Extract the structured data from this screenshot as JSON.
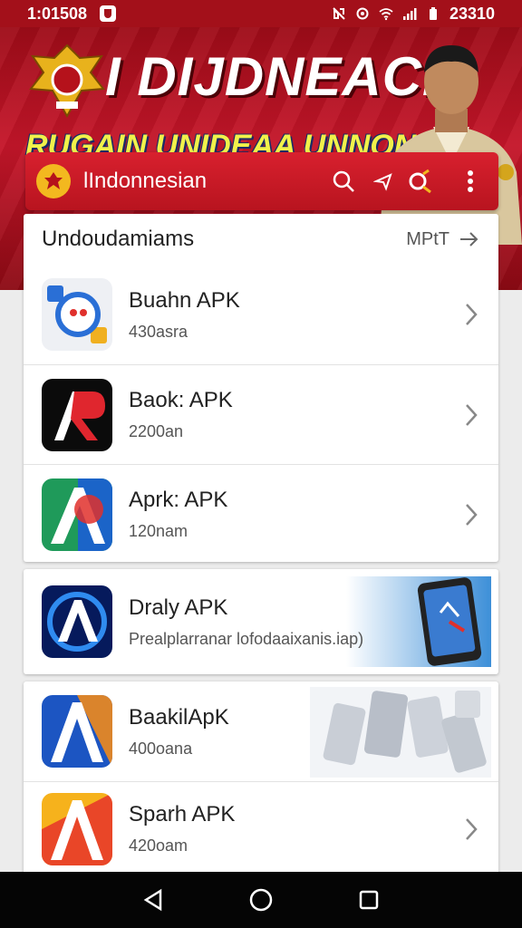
{
  "status_bar": {
    "time": "1:01508",
    "right_text": "23310"
  },
  "banner": {
    "title": "I DIJDNEACLI",
    "subtitle": "RUGAIN UNIDEAA UNNONAN!"
  },
  "search_bar": {
    "label": "lIndonnesian"
  },
  "sections": [
    {
      "title": "Undoudamiams",
      "more_label": "MPtT",
      "items": [
        {
          "name": "Buahn APK",
          "subtitle": "430asra"
        },
        {
          "name": "Baok: APK",
          "subtitle": "2200an"
        },
        {
          "name": "Aprk: APK",
          "subtitle": "120nam"
        }
      ]
    }
  ],
  "promo": {
    "name": "Draly APK",
    "subtitle": "Prealplarranar lofodaaixanis.iap)"
  },
  "list2": {
    "items": [
      {
        "name": "BaakilApK",
        "subtitle": "400oana"
      },
      {
        "name": "Sparh APK",
        "subtitle": "420oam"
      }
    ]
  },
  "colors": {
    "brand_red": "#c5162a",
    "banner_dark": "#9e0c18",
    "subtitle_yellow": "#f1f14a",
    "nav_black": "#050505"
  }
}
